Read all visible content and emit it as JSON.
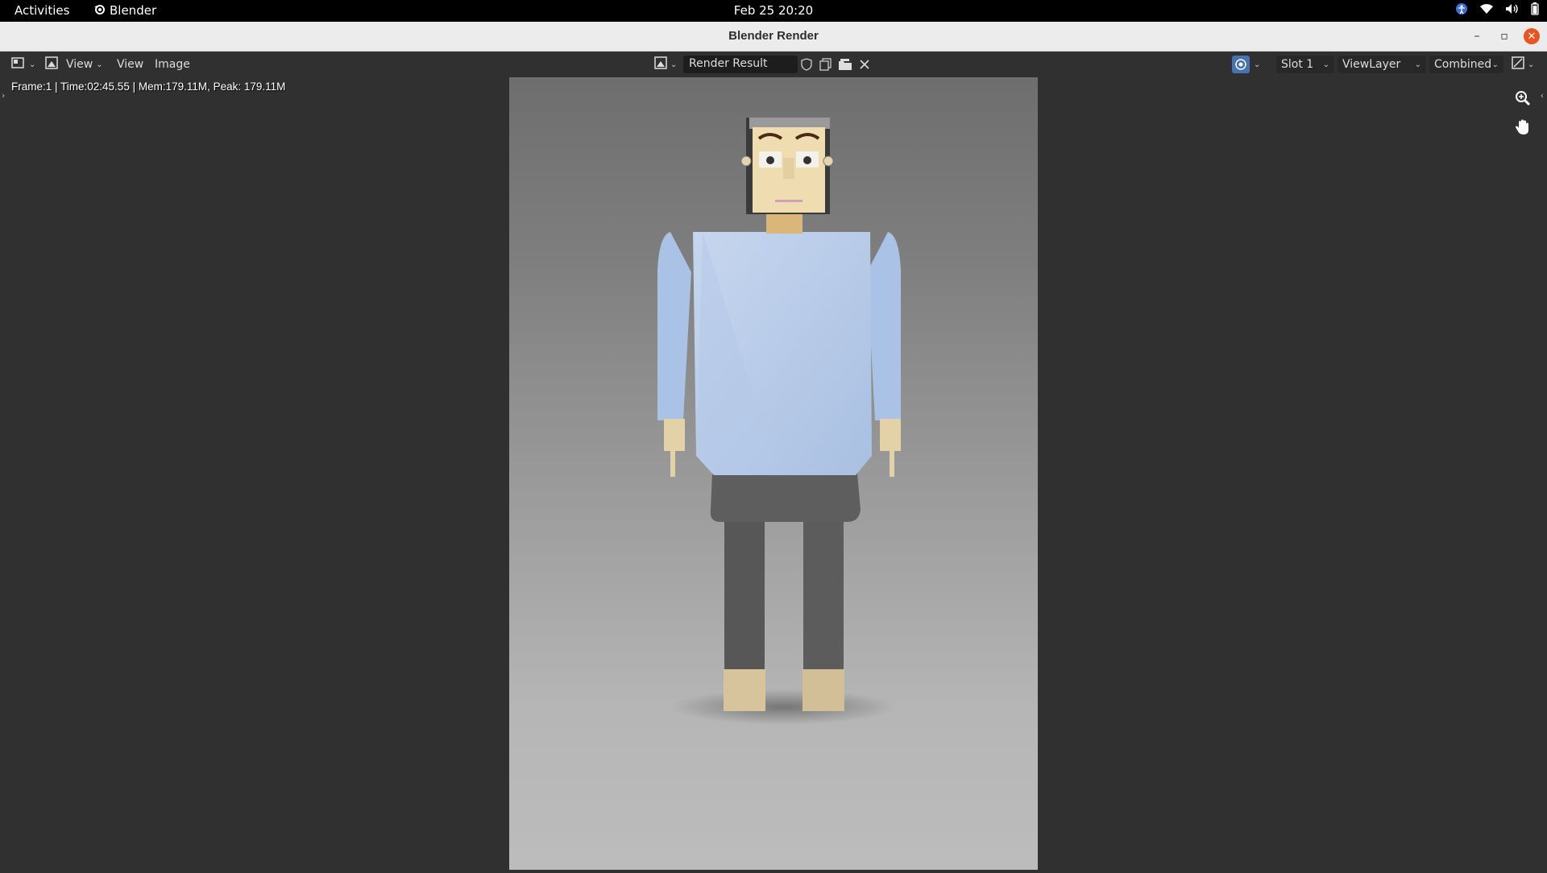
{
  "system_bar": {
    "activities": "Activities",
    "app_name": "Blender",
    "datetime": "Feb 25  20:20"
  },
  "window": {
    "title": "Blender Render",
    "minimize": "–",
    "maximize": "▫",
    "close": "✕"
  },
  "header": {
    "view_menu_label": "View",
    "view_menu2_label": "View",
    "image_menu_label": "Image",
    "image_name": "Render Result",
    "slot": "Slot 1",
    "view_layer": "ViewLayer",
    "pass": "Combined"
  },
  "render_info": {
    "stats": "Frame:1 | Time:02:45.55 | Mem:179.11M, Peak: 179.11M"
  },
  "icons": [
    "editor-type-icon",
    "image-icon",
    "fake-user-shield-icon",
    "new-image-icon",
    "open-image-icon",
    "unlink-close-icon",
    "render-slot-icon",
    "display-mode-icon",
    "zoom-icon",
    "pan-hand-icon",
    "blender-logo-icon",
    "wifi-icon",
    "volume-icon",
    "battery-icon",
    "accessibility-icon"
  ],
  "colors": {
    "accent_blue": "#4772b3",
    "close_orange": "#e95420",
    "shirt": "#b7cbe6",
    "skin": "#eedcb0",
    "pants": "#5a5a5a"
  }
}
